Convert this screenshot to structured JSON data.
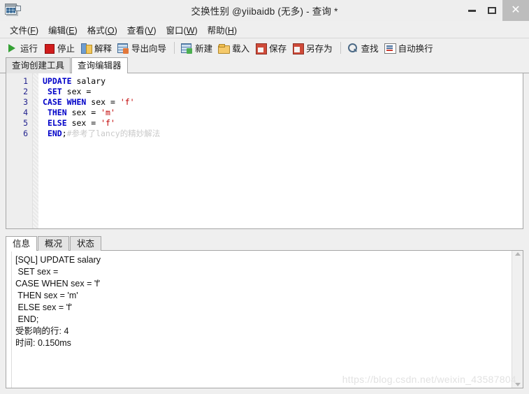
{
  "window": {
    "title": "交换性别 @yiibaidb (无多) - 查询 *",
    "icon": "table-window-icon",
    "controls": {
      "minimize": "minimize-icon",
      "maximize": "maximize-icon",
      "close": "✕"
    }
  },
  "menubar": {
    "items": [
      {
        "label": "文件",
        "accel": "F"
      },
      {
        "label": "编辑",
        "accel": "E"
      },
      {
        "label": "格式",
        "accel": "O"
      },
      {
        "label": "查看",
        "accel": "V"
      },
      {
        "label": "窗口",
        "accel": "W"
      },
      {
        "label": "帮助",
        "accel": "H"
      }
    ]
  },
  "toolbar": {
    "groups": [
      [
        {
          "label": "运行",
          "icon": "run-icon"
        },
        {
          "label": "停止",
          "icon": "stop-icon"
        },
        {
          "label": "解释",
          "icon": "explain-icon"
        },
        {
          "label": "导出向导",
          "icon": "export-wizard-icon"
        }
      ],
      [
        {
          "label": "新建",
          "icon": "new-icon"
        },
        {
          "label": "载入",
          "icon": "open-folder-icon"
        },
        {
          "label": "保存",
          "icon": "save-icon"
        },
        {
          "label": "另存为",
          "icon": "save-as-icon"
        }
      ],
      [
        {
          "label": "查找",
          "icon": "search-icon"
        },
        {
          "label": "自动换行",
          "icon": "word-wrap-icon"
        }
      ]
    ]
  },
  "editor_tabs": {
    "items": [
      {
        "label": "查询创建工具",
        "active": false
      },
      {
        "label": "查询编辑器",
        "active": true
      }
    ]
  },
  "editor": {
    "line_numbers": [
      "1",
      "2",
      "3",
      "4",
      "5",
      "6"
    ],
    "lines": [
      [
        {
          "t": "UPDATE",
          "c": "kw"
        },
        {
          "t": " salary",
          "c": "pl"
        }
      ],
      [
        {
          "t": " ",
          "c": "pl"
        },
        {
          "t": "SET",
          "c": "kw"
        },
        {
          "t": " sex = ",
          "c": "pl"
        }
      ],
      [
        {
          "t": "CASE",
          "c": "kw"
        },
        {
          "t": " ",
          "c": "pl"
        },
        {
          "t": "WHEN",
          "c": "kw"
        },
        {
          "t": " sex = ",
          "c": "pl"
        },
        {
          "t": "'f'",
          "c": "str"
        }
      ],
      [
        {
          "t": " ",
          "c": "pl"
        },
        {
          "t": "THEN",
          "c": "kw"
        },
        {
          "t": " sex = ",
          "c": "pl"
        },
        {
          "t": "'m'",
          "c": "str"
        }
      ],
      [
        {
          "t": " ",
          "c": "pl"
        },
        {
          "t": "ELSE",
          "c": "kw"
        },
        {
          "t": " sex = ",
          "c": "pl"
        },
        {
          "t": "'f'",
          "c": "str"
        }
      ],
      [
        {
          "t": " ",
          "c": "pl"
        },
        {
          "t": "END",
          "c": "kw"
        },
        {
          "t": ";",
          "c": "pl"
        },
        {
          "t": "#参考了lancy的精妙解法",
          "c": "cmt"
        }
      ]
    ]
  },
  "bottom_tabs": {
    "items": [
      {
        "label": "信息",
        "active": true
      },
      {
        "label": "概况",
        "active": false
      },
      {
        "label": "状态",
        "active": false
      }
    ]
  },
  "output": {
    "lines": [
      "[SQL] UPDATE salary",
      " SET sex =",
      "CASE WHEN sex = 'f'",
      " THEN sex = 'm'",
      " ELSE sex = 'f'",
      " END;",
      "受影响的行: 4",
      "时间: 0.150ms"
    ]
  },
  "scrollbar": {
    "up": "scroll-up-arrow",
    "down": "scroll-down-arrow"
  },
  "watermark": {
    "text": "https://blog.csdn.net/weixin_43587804"
  }
}
